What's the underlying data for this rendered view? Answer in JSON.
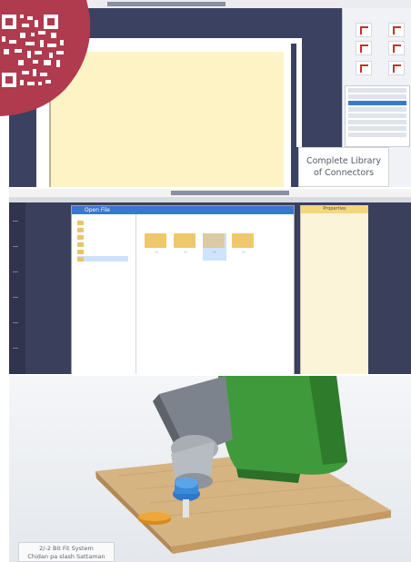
{
  "qr_badge": {
    "icon": "qr-code-icon",
    "color": "#b03a4e"
  },
  "panel1": {
    "caption": "Complete Library of Connectors",
    "accent": "#cc2d2d"
  },
  "panel2": {
    "dialog_title": "Open File",
    "right_panel_header": "Properties"
  },
  "panel3": {
    "label_line1": "2/-2 Bit Fit System",
    "label_line2": "Chidan pa slash Sattaman"
  }
}
